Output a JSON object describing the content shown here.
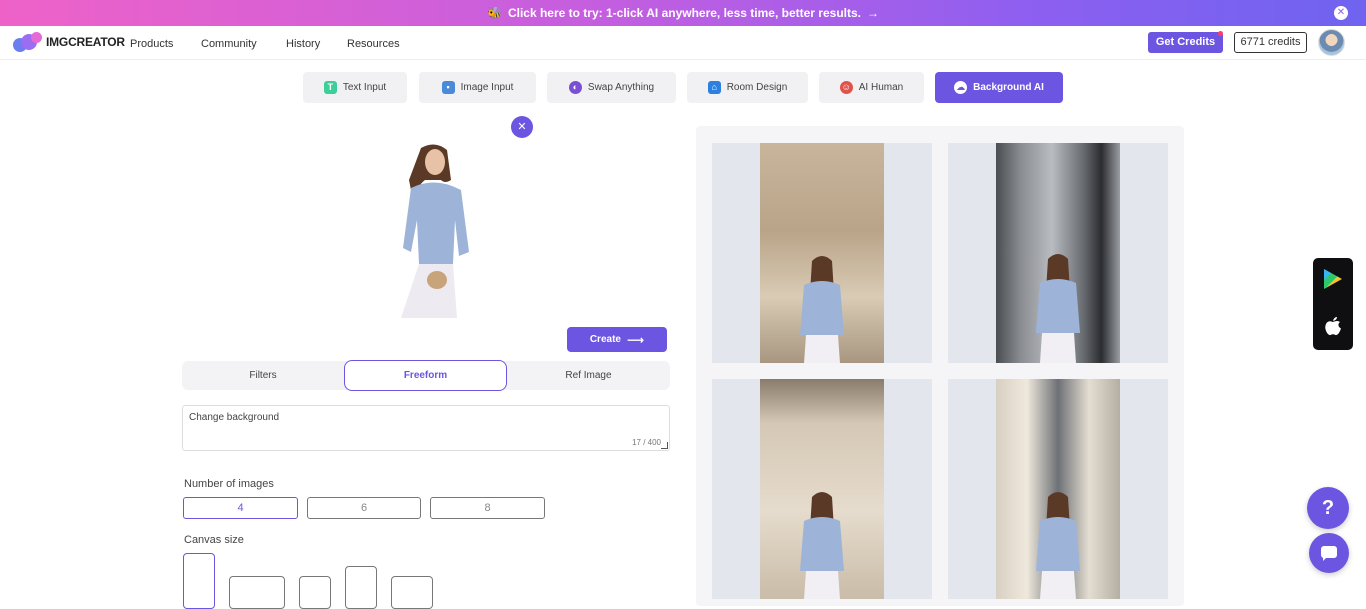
{
  "banner": {
    "text": "Click here to try: 1-click AI anywhere, less time, better results.",
    "arrow": "→",
    "close": "✕"
  },
  "nav": {
    "logo": "IMGCREATOR",
    "links": [
      "Products",
      "Community",
      "History",
      "Resources"
    ],
    "get_credits": "Get Credits",
    "credits": "6771 credits"
  },
  "tabs": [
    {
      "label": "Text Input",
      "icon": "text-icon",
      "icon_color": "#3ccf9a"
    },
    {
      "label": "Image Input",
      "icon": "image-icon",
      "icon_color": "#4a8bd9"
    },
    {
      "label": "Swap Anything",
      "icon": "swap-icon",
      "icon_color": "#7a4fd6"
    },
    {
      "label": "Room Design",
      "icon": "house-icon",
      "icon_color": "#2d7fe0"
    },
    {
      "label": "AI Human",
      "icon": "human-icon",
      "icon_color": "#e0534a"
    },
    {
      "label": "Background AI",
      "icon": "background-icon",
      "icon_color": "#ffffff"
    }
  ],
  "upload": {
    "remove": "✕"
  },
  "create": {
    "label": "Create",
    "arrow": "⟶"
  },
  "modes": [
    "Filters",
    "Freeform",
    "Ref Image"
  ],
  "prompt": {
    "value": "Change background",
    "count": "17 / 400"
  },
  "number_of_images": {
    "label": "Number of images",
    "options": [
      "4",
      "6",
      "8"
    ],
    "selected": "4"
  },
  "canvas_size": {
    "label": "Canvas size"
  },
  "help": {
    "label": "?"
  },
  "colors": {
    "accent": "#6c55e0"
  }
}
